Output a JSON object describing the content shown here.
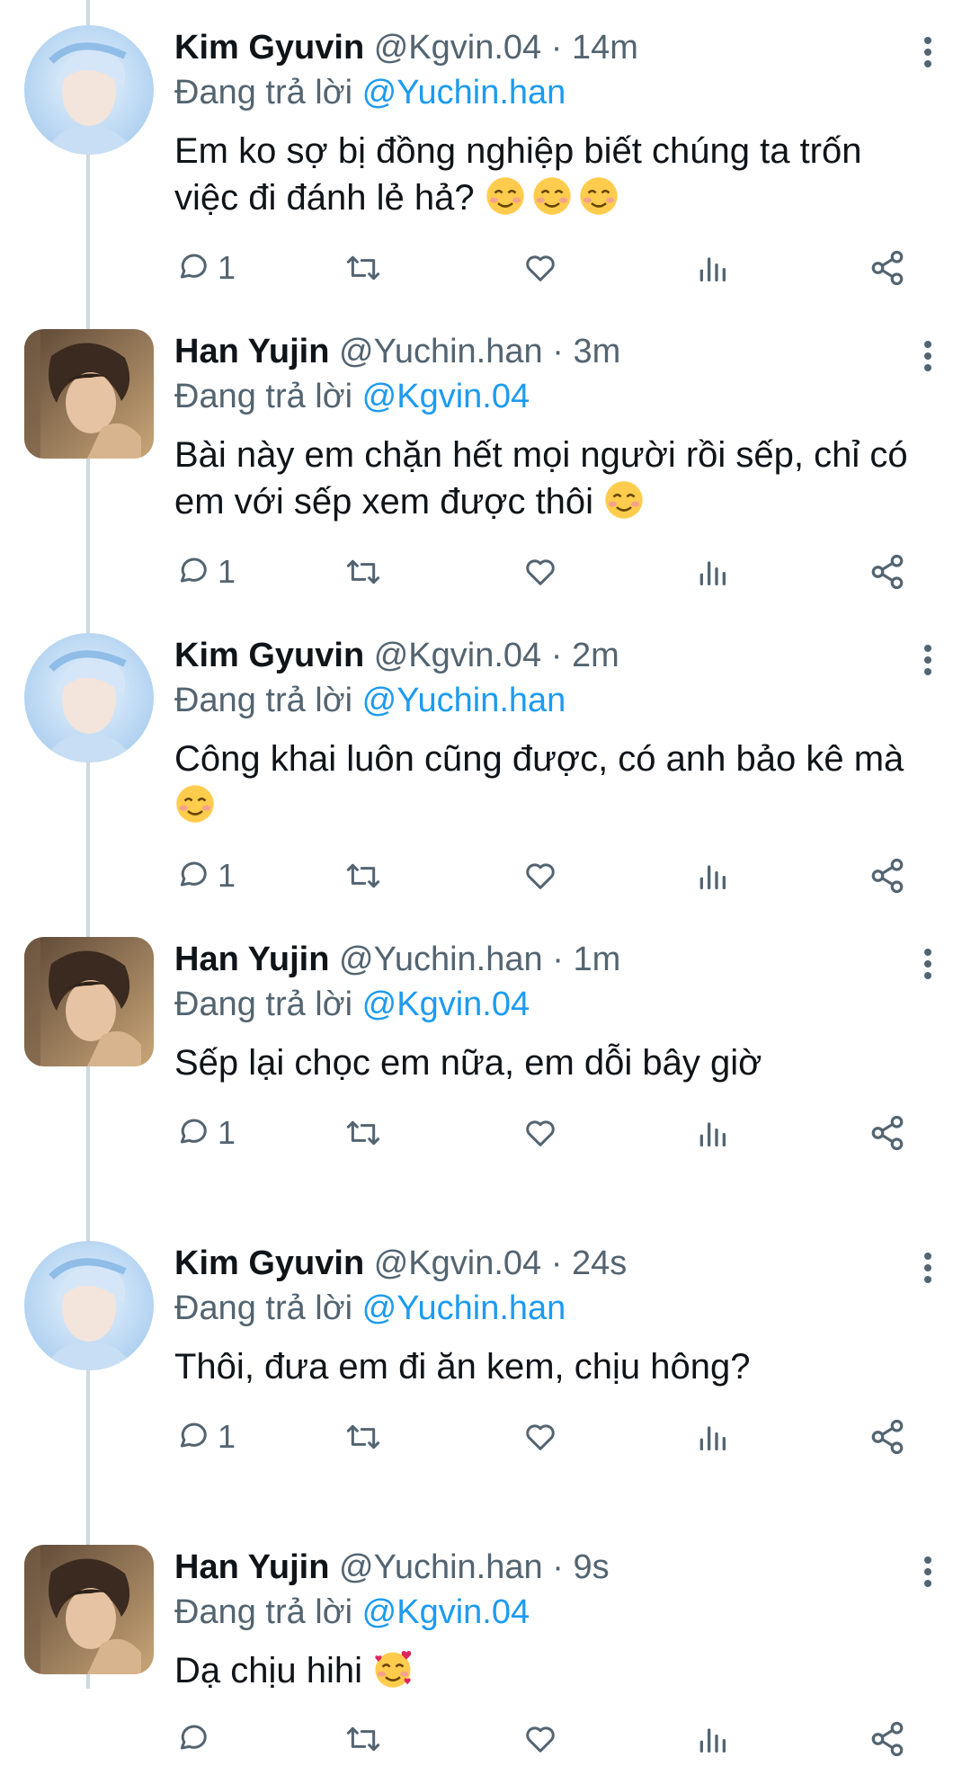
{
  "colors": {
    "link": "#1d9bf0",
    "text": "#0f1419",
    "secondary": "#536471",
    "thread_line": "#cfd9de"
  },
  "tweets": [
    {
      "display_name": "Kim Gyuvin",
      "handle": "@Kgvin.04",
      "separator": " · ",
      "time": "14m",
      "reply_prefix": "Đang trả lời ",
      "reply_to": "@Yuchin.han",
      "text": "Em ko sợ bị đồng nghiệp biết chúng ta trốn việc đi đánh lẻ hả?",
      "emojis": [
        "smiling-face-icon",
        "smiling-face-icon",
        "smiling-face-icon"
      ],
      "reply_count": "1",
      "avatar": "avatar-kim-gyuvin"
    },
    {
      "display_name": "Han Yujin",
      "handle": "@Yuchin.han",
      "separator": " · ",
      "time": "3m",
      "reply_prefix": "Đang trả lời ",
      "reply_to": "@Kgvin.04",
      "text": "Bài này em chặn hết mọi người rồi sếp, chỉ có em với sếp xem được thôi",
      "emojis": [
        "smiling-face-icon"
      ],
      "reply_count": "1",
      "avatar": "avatar-han-yujin"
    },
    {
      "display_name": "Kim Gyuvin",
      "handle": "@Kgvin.04",
      "separator": " · ",
      "time": "2m",
      "reply_prefix": "Đang trả lời ",
      "reply_to": "@Yuchin.han",
      "text": "Công khai luôn cũng được, có anh bảo kê mà",
      "emojis": [
        "smiling-face-icon"
      ],
      "reply_count": "1",
      "avatar": "avatar-kim-gyuvin"
    },
    {
      "display_name": "Han Yujin",
      "handle": "@Yuchin.han",
      "separator": " · ",
      "time": "1m",
      "reply_prefix": "Đang trả lời ",
      "reply_to": "@Kgvin.04",
      "text": "Sếp lại chọc em nữa, em dỗi bây giờ",
      "emojis": [],
      "reply_count": "1",
      "avatar": "avatar-han-yujin"
    },
    {
      "display_name": "Kim Gyuvin",
      "handle": "@Kgvin.04",
      "separator": " · ",
      "time": "24s",
      "reply_prefix": "Đang trả lời ",
      "reply_to": "@Yuchin.han",
      "text": "Thôi, đưa em đi ăn kem, chịu hông?",
      "emojis": [],
      "reply_count": "1",
      "avatar": "avatar-kim-gyuvin"
    },
    {
      "display_name": "Han Yujin",
      "handle": "@Yuchin.han",
      "separator": " · ",
      "time": "9s",
      "reply_prefix": "Đang trả lời ",
      "reply_to": "@Kgvin.04",
      "text": "Dạ chịu hihi",
      "emojis": [
        "smiling-face-with-hearts-icon"
      ],
      "reply_count": "",
      "avatar": "avatar-han-yujin"
    }
  ],
  "action_icons": [
    "reply-icon",
    "retweet-icon",
    "like-icon",
    "views-icon",
    "share-icon"
  ],
  "more_icon": "more-vertical-icon"
}
